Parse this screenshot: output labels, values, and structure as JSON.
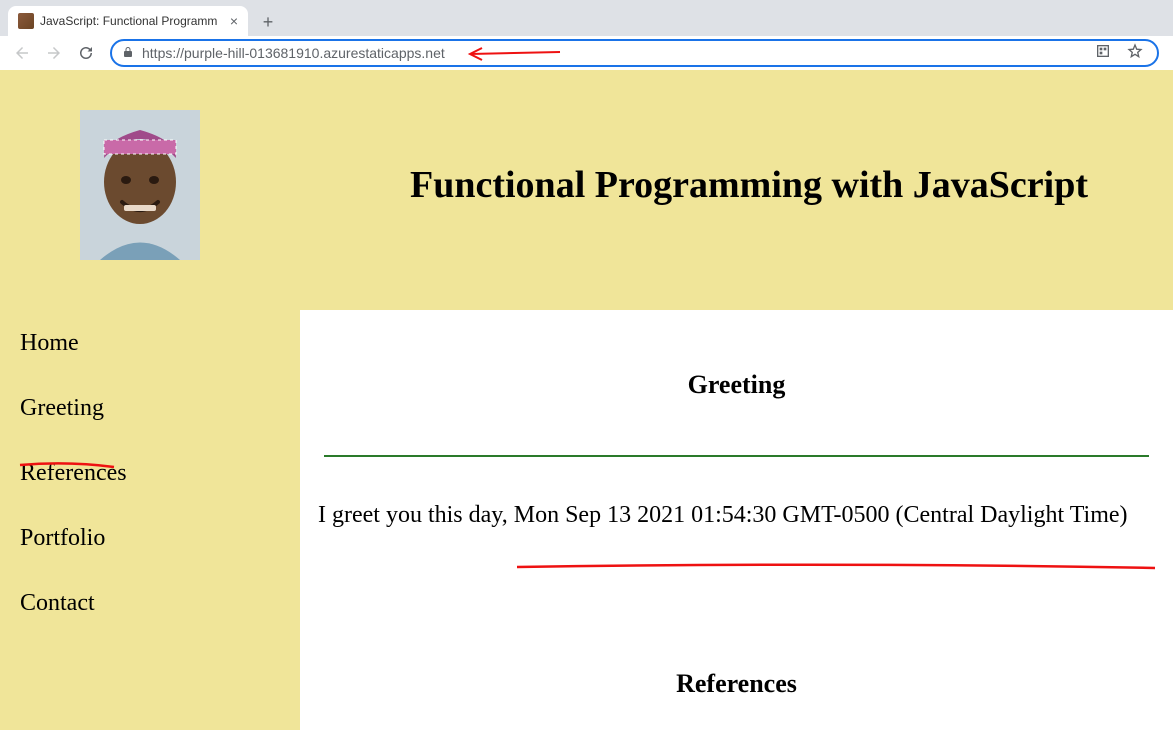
{
  "browser": {
    "tab_title": "JavaScript: Functional Programm",
    "url": "https://purple-hill-013681910.azurestaticapps.net"
  },
  "header": {
    "page_title": "Functional Programming with JavaScript"
  },
  "sidebar": {
    "items": [
      "Home",
      "Greeting",
      "References",
      "Portfolio",
      "Contact"
    ]
  },
  "content": {
    "greeting_heading": "Greeting",
    "greeting_text": "I greet you this day, Mon Sep 13 2021 01:54:30 GMT-0500 (Central Daylight Time)",
    "references_heading": "References"
  }
}
